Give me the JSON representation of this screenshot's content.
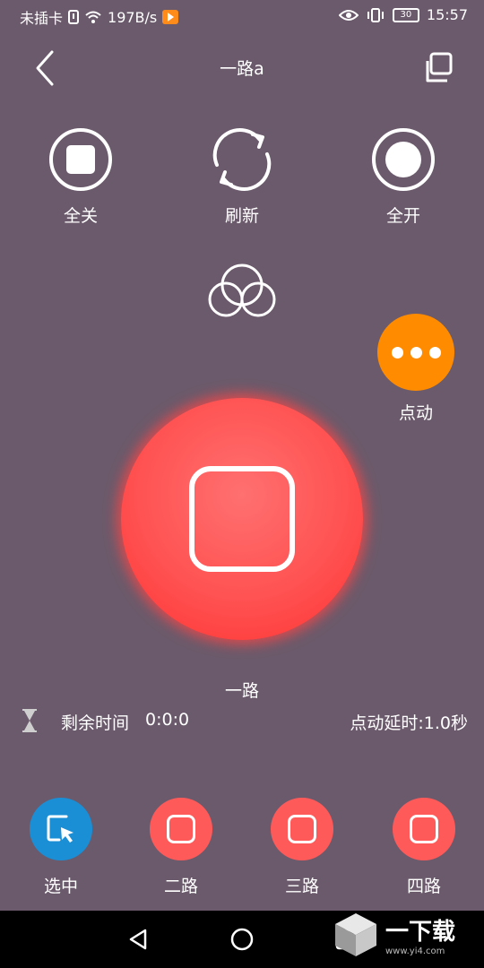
{
  "status_bar": {
    "carrier": "未插卡",
    "speed": "197B/s",
    "battery": "30",
    "time": "15:57"
  },
  "header": {
    "title": "一路a"
  },
  "controls": {
    "all_off": "全关",
    "refresh": "刷新",
    "all_on": "全开"
  },
  "jog": {
    "label": "点动"
  },
  "main": {
    "channel_name": "一路"
  },
  "timer": {
    "remaining_label": "剩余时间",
    "remaining_value": "0:0:0",
    "delay_text": "点动延时:1.0秒"
  },
  "channels": [
    {
      "label": "选中"
    },
    {
      "label": "二路"
    },
    {
      "label": "三路"
    },
    {
      "label": "四路"
    }
  ],
  "watermark": {
    "text": "一下载",
    "url": "www.yi4.com"
  },
  "colors": {
    "background": "#6b5a6b",
    "main_button": "#ff5252",
    "jog_button": "#ff8c00",
    "channel_button": "#ff5a5a",
    "selected_channel": "#1a8fd6"
  }
}
